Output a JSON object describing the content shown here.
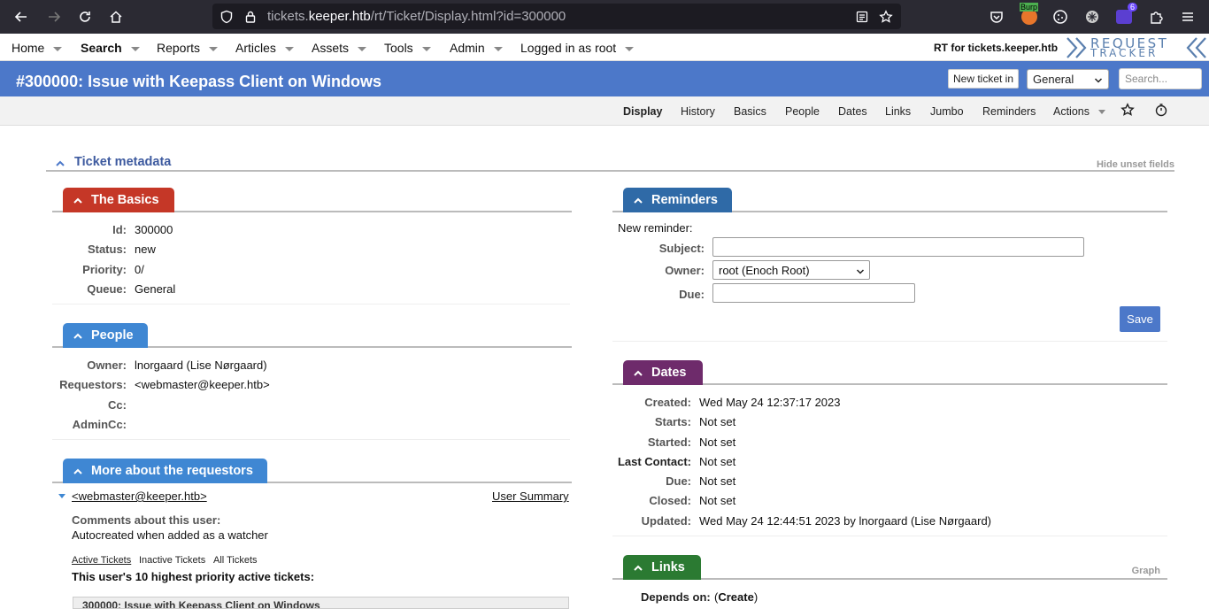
{
  "browser": {
    "url_prefix": "tickets.",
    "url_host": "keeper.htb",
    "url_path": "/rt/Ticket/Display.html?id=300000",
    "burp_label": "Burp",
    "badge_count": "6"
  },
  "topnav": {
    "items": [
      "Home",
      "Search",
      "Reports",
      "Articles",
      "Assets",
      "Tools",
      "Admin",
      "Logged in as root"
    ],
    "rt_for": "RT for tickets.keeper.htb",
    "logo_line1": "REQUEST",
    "logo_line2": "TRACKER"
  },
  "titlebar": {
    "title": "#300000: Issue with Keepass Client on Windows",
    "new_ticket": "New ticket in",
    "queue": "General",
    "search_placeholder": "Search..."
  },
  "pagetabs": [
    "Display",
    "History",
    "Basics",
    "People",
    "Dates",
    "Links",
    "Jumbo",
    "Reminders",
    "Actions"
  ],
  "metadata": {
    "title": "Ticket metadata",
    "hide_unset": "Hide unset fields"
  },
  "basics": {
    "title": "The Basics",
    "color": "#c0392b",
    "fields": [
      {
        "label": "Id:",
        "value": "300000"
      },
      {
        "label": "Status:",
        "value": "new"
      },
      {
        "label": "Priority:",
        "value": "0/"
      },
      {
        "label": "Queue:",
        "value": "General"
      }
    ]
  },
  "people": {
    "title": "People",
    "color": "#3b8bd6",
    "fields": [
      {
        "label": "Owner:",
        "value": "lnorgaard (Lise Nørgaard)"
      },
      {
        "label": "Requestors:",
        "value": "<webmaster@keeper.htb>"
      },
      {
        "label": "Cc:",
        "value": ""
      },
      {
        "label": "AdminCc:",
        "value": ""
      }
    ]
  },
  "requestors": {
    "title": "More about the requestors",
    "color": "#3b8bd6",
    "email": "<webmaster@keeper.htb>",
    "user_summary": "User Summary",
    "comments_label": "Comments about this user:",
    "comments": "Autocreated when added as a watcher",
    "tabs": [
      "Active Tickets",
      "Inactive Tickets",
      "All Tickets"
    ],
    "top_tickets": "This user's 10 highest priority active tickets:",
    "ticket_row": "300000: Issue with Keepass Client on Windows"
  },
  "reminders": {
    "title": "Reminders",
    "color": "#2f6aa7",
    "new_reminder": "New reminder:",
    "subject_label": "Subject:",
    "owner_label": "Owner:",
    "owner_value": "root (Enoch Root)",
    "due_label": "Due:",
    "save": "Save"
  },
  "dates": {
    "title": "Dates",
    "color": "#6b2d6b",
    "fields": [
      {
        "label": "Created:",
        "value": "Wed May 24 12:37:17 2023"
      },
      {
        "label": "Starts:",
        "value": "Not set"
      },
      {
        "label": "Started:",
        "value": "Not set"
      },
      {
        "label": "Last Contact:",
        "value": "Not set"
      },
      {
        "label": "Due:",
        "value": "Not set"
      },
      {
        "label": "Closed:",
        "value": "Not set"
      },
      {
        "label": "Updated:",
        "value": "Wed May 24 12:44:51 2023 by lnorgaard (Lise Nørgaard)"
      }
    ]
  },
  "links": {
    "title": "Links",
    "color": "#2e7d32",
    "graph": "Graph",
    "depends_on": "Depends on:",
    "open_paren": "(",
    "create": "Create",
    "close_paren": ")"
  }
}
